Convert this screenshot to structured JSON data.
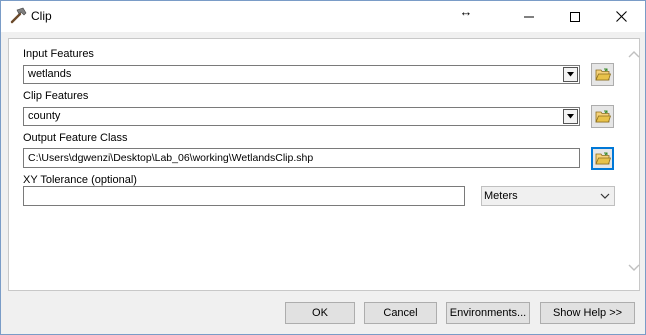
{
  "window": {
    "title": "Clip",
    "title_icon": "hammer-icon",
    "resize_glyph": "↔",
    "controls": [
      "minimize-icon",
      "maximize-icon",
      "close-icon"
    ]
  },
  "form": {
    "input_features": {
      "label": "Input Features",
      "value": "wetlands"
    },
    "clip_features": {
      "label": "Clip Features",
      "value": "county"
    },
    "output_feature_class": {
      "label": "Output Feature Class",
      "value": "C:\\Users\\dgwenzi\\Desktop\\Lab_06\\working\\WetlandsClip.shp"
    },
    "xy_tolerance": {
      "label": "XY Tolerance (optional)",
      "value": "",
      "units": "Meters"
    }
  },
  "buttons": {
    "ok": "OK",
    "cancel": "Cancel",
    "environments": "Environments...",
    "show_help": "Show Help >>"
  },
  "colors": {
    "focus_blue": "#0078d7",
    "folder_yellow": "#e8c24a"
  }
}
